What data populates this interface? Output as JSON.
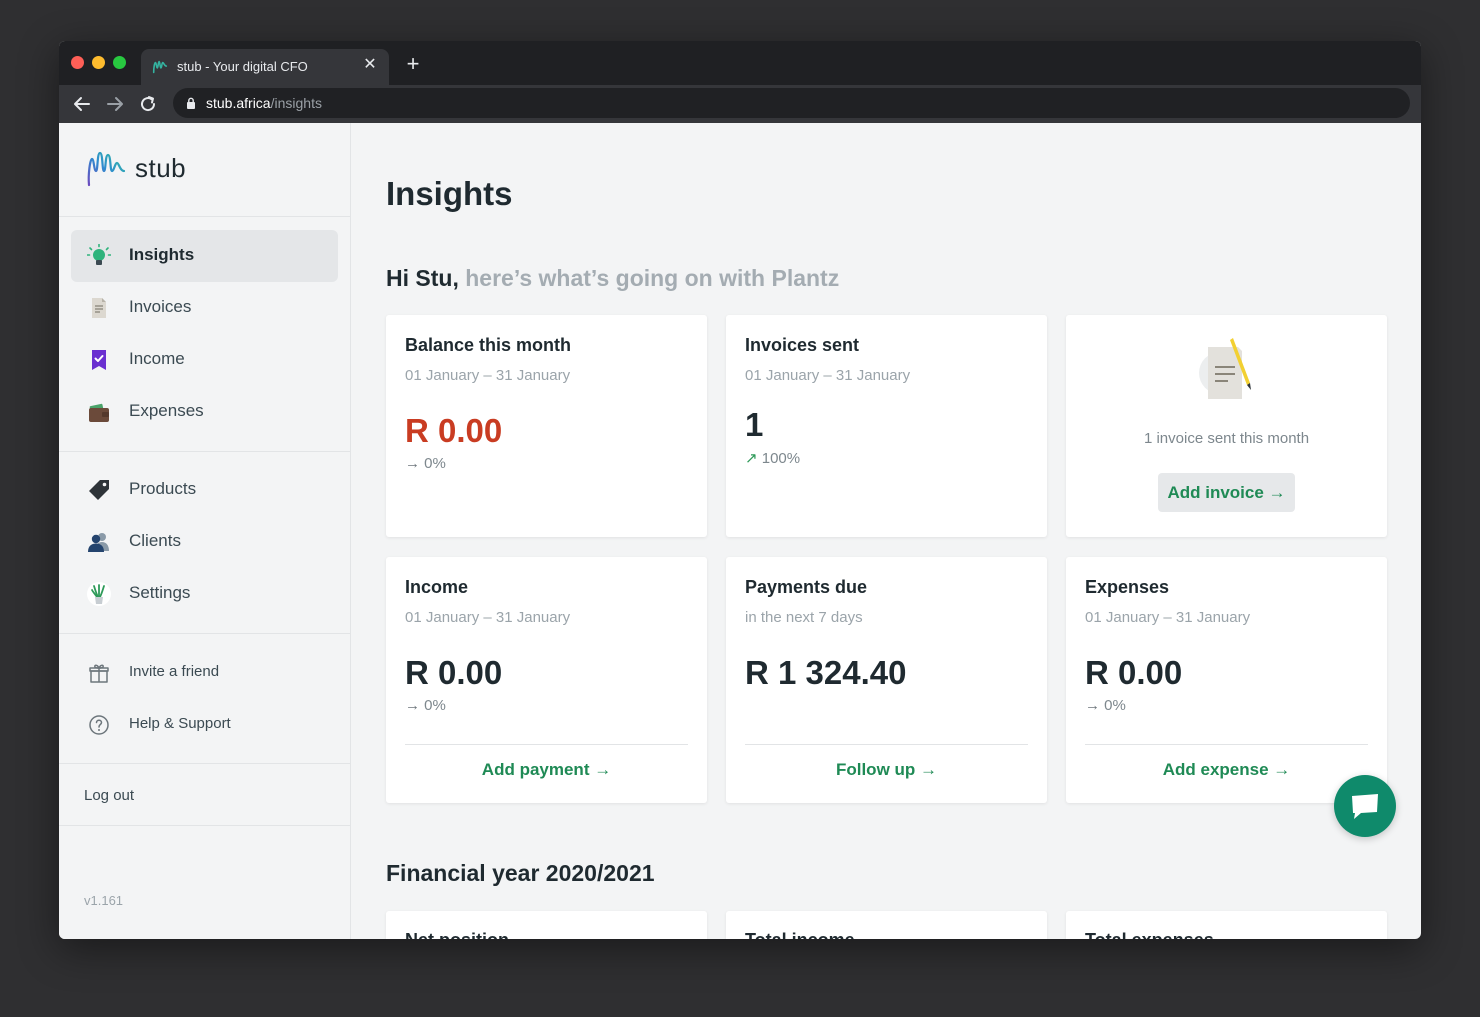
{
  "browser": {
    "tab_title": "stub - Your digital CFO",
    "url_host": "stub.africa",
    "url_path": "/insights"
  },
  "brand": {
    "name": "stub"
  },
  "sidebar": {
    "primary": [
      {
        "label": "Insights",
        "icon": "lightbulb-icon",
        "active": true
      },
      {
        "label": "Invoices",
        "icon": "document-icon"
      },
      {
        "label": "Income",
        "icon": "checkmark-bookmark-icon"
      },
      {
        "label": "Expenses",
        "icon": "wallet-icon"
      }
    ],
    "secondary": [
      {
        "label": "Products",
        "icon": "tag-icon"
      },
      {
        "label": "Clients",
        "icon": "people-icon"
      },
      {
        "label": "Settings",
        "icon": "plant-icon"
      }
    ],
    "support": [
      {
        "label": "Invite a friend",
        "icon": "gift-icon"
      },
      {
        "label": "Help & Support",
        "icon": "question-icon"
      }
    ],
    "logout": "Log out",
    "version": "v1.161"
  },
  "page": {
    "title": "Insights",
    "greeting_name": "Hi Stu,",
    "greeting_rest": "here’s what’s going on with Plantz"
  },
  "cards": {
    "balance": {
      "title": "Balance this month",
      "subtitle": "01 January – 31 January",
      "value": "R 0.00",
      "change_arrow": "→",
      "change": "0%"
    },
    "invoices_sent": {
      "title": "Invoices sent",
      "subtitle": "01 January – 31 January",
      "value": "1",
      "change_arrow": "↗",
      "change": "100%"
    },
    "invoice_note": {
      "text": "1 invoice sent this month",
      "button": "Add invoice →"
    },
    "income": {
      "title": "Income",
      "subtitle": "01 January – 31 January",
      "value": "R 0.00",
      "change_arrow": "→",
      "change": "0%",
      "link": "Add payment →"
    },
    "payments_due": {
      "title": "Payments due",
      "subtitle": "in the next 7 days",
      "value": "R 1 324.40",
      "link": "Follow up →"
    },
    "expenses": {
      "title": "Expenses",
      "subtitle": "01 January – 31 January",
      "value": "R 0.00",
      "change_arrow": "→",
      "change": "0%",
      "link": "Add expense →"
    }
  },
  "financial_year": {
    "title": "Financial year 2020/2021",
    "cards": [
      "Net position",
      "Total income",
      "Total expenses"
    ]
  },
  "colors": {
    "accent_green": "#1f8a55",
    "negative_red": "#c93c22",
    "chat_button": "#0f8a6b"
  }
}
